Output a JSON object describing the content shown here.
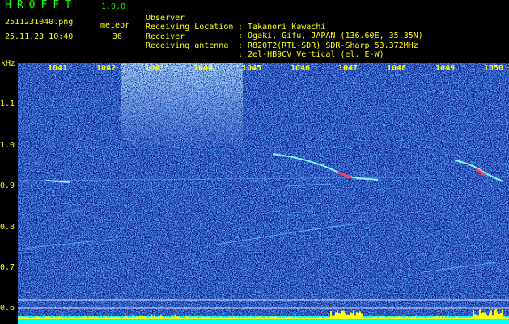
{
  "header": {
    "title": "HROFFT",
    "version": "1.0.0",
    "filename": "2511231040.png",
    "datetime": "25.11.23 10:40",
    "mode_label": "meteor",
    "meteor_count": "36"
  },
  "station_info": [
    {
      "label": "Observer",
      "value": ": Takanori Kawachi"
    },
    {
      "label": "Receiving Location",
      "value": ": Ogaki, Gifu, JAPAN (136.60E, 35.35N)"
    },
    {
      "label": "Receiver",
      "value": ": R820T2(RTL-SDR) SDR-Sharp 53.372MHz"
    },
    {
      "label": "Receiving antenna",
      "value": ": 2el-HB9CV Vertical (el. E-W)"
    }
  ],
  "axes": {
    "y_unit": "kHz",
    "y_ticks": [
      "1.1",
      "1.0",
      "0.9",
      "0.8",
      "0.7",
      "0.6"
    ],
    "x_ticks": [
      "1041",
      "1042",
      "1043",
      "1044",
      "1045",
      "1046",
      "1047",
      "1048",
      "1049",
      "1050"
    ]
  },
  "colors": {
    "title": "#00ff00",
    "text": "#ffffff",
    "yellow": "#ffff00",
    "labels": "#ffff00",
    "background_noise": "#06208a",
    "activity_bar": "#ffff00",
    "baseline": "#00ffff"
  }
}
